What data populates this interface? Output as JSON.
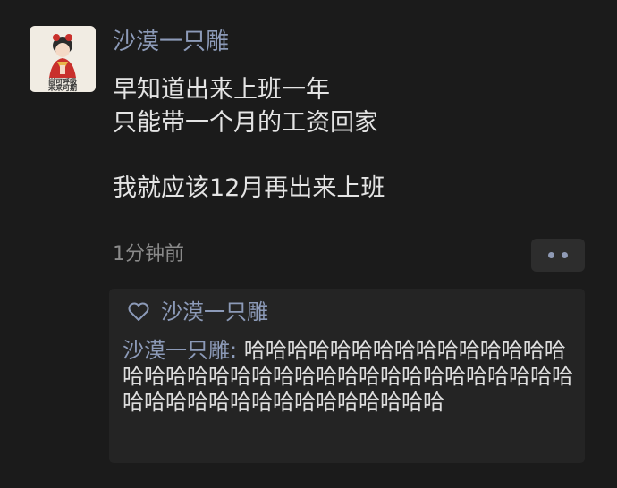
{
  "post": {
    "avatar_text_line1": "尚可呼吸",
    "avatar_text_line2": "未来可期",
    "username": "沙漠一只雕",
    "line1": "早知道出来上班一年",
    "line2": "只能带一个月的工资回家",
    "line3": "我就应该12月再出来上班",
    "timestamp": "1分钟前"
  },
  "interactions": {
    "like_icon": "heart-outline-icon",
    "liked_by": "沙漠一只雕",
    "comments": [
      {
        "author": "沙漠一只雕",
        "separator": ": ",
        "text": "哈哈哈哈哈哈哈哈哈哈哈哈哈哈哈哈哈哈哈哈哈哈哈哈哈哈哈哈哈哈哈哈哈哈哈哈哈哈哈哈哈哈哈哈哈哈哈哈哈哈哈"
      }
    ]
  },
  "colors": {
    "background": "#1b1b1b",
    "name_link": "#8c9ab8",
    "body_text": "#e4e4e4",
    "muted": "#8a8a8a",
    "panel": "#242424"
  }
}
